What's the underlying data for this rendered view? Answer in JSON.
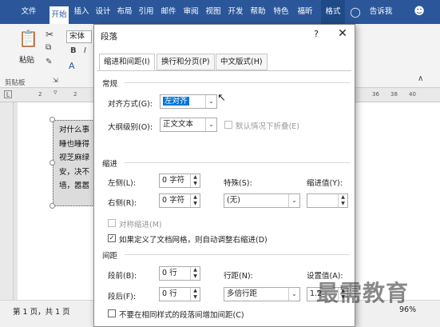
{
  "ribbon": {
    "tabs": [
      "文件",
      "开始",
      "插入",
      "设计",
      "布局",
      "引用",
      "邮件",
      "审阅",
      "视图",
      "开发",
      "帮助",
      "特色",
      "福昕",
      "格式",
      "告诉我"
    ],
    "paste_label": "粘贴",
    "font_name": "宋体",
    "clipboard_group": "剪贴板"
  },
  "ruler": {
    "left_nums": [
      "2",
      "2"
    ],
    "right_nums": [
      "36",
      "38",
      "40"
    ]
  },
  "document": {
    "lines": [
      "对什么事",
      "睡也睡得",
      "视芝麻绿",
      "安，决不",
      "墙，嚣嚣"
    ]
  },
  "status": {
    "page": "第 1 页，共 1 页",
    "zoom": "96%"
  },
  "watermark": "最需教育",
  "dialog": {
    "title": "段落",
    "help": "?",
    "close": "✕",
    "tabs": [
      "缩进和间距(I)",
      "换行和分页(P)",
      "中文版式(H)"
    ],
    "general": {
      "section": "常规",
      "align_label": "对齐方式(G):",
      "align_value": "左对齐",
      "outline_label": "大纲级别(O):",
      "outline_value": "正文文本",
      "collapse_label": "默认情况下折叠(E)"
    },
    "indent": {
      "section": "缩进",
      "left_label": "左侧(L):",
      "left_value": "0 字符",
      "right_label": "右侧(R):",
      "right_value": "0 字符",
      "special_label": "特殊(S):",
      "special_value": "(无)",
      "by_label": "缩进值(Y):",
      "mirror_label": "对称缩进(M)",
      "auto_adjust_label": "如果定义了文档网格，则自动调整右缩进(D)"
    },
    "spacing": {
      "section": "间距",
      "before_label": "段前(B):",
      "before_value": "0 行",
      "after_label": "段后(F):",
      "after_value": "0 行",
      "line_label": "行距(N):",
      "line_value": "多倍行距",
      "at_label": "设置值(A):",
      "at_value": "1.2",
      "no_space_label": "不要在相同样式的段落间增加间距(C)"
    }
  }
}
